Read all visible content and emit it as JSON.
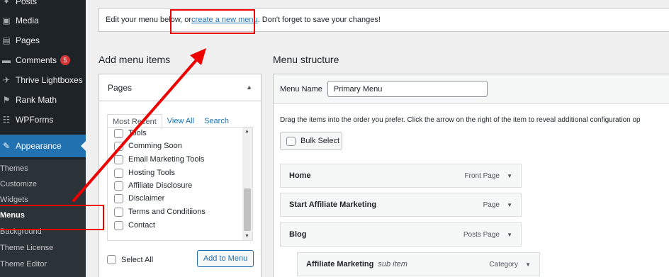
{
  "sidebar": {
    "items": [
      {
        "label": "Posts",
        "icon": "pin-icon"
      },
      {
        "label": "Media",
        "icon": "media-icon"
      },
      {
        "label": "Pages",
        "icon": "pages-icon"
      },
      {
        "label": "Comments",
        "icon": "comment-icon",
        "badge": "5"
      },
      {
        "label": "Thrive Lightboxes",
        "icon": "pin-icon"
      },
      {
        "label": "Rank Math",
        "icon": "chart-icon"
      },
      {
        "label": "WPForms",
        "icon": "forms-icon"
      }
    ],
    "appearance": "Appearance",
    "submenu": [
      "Themes",
      "Customize",
      "Widgets",
      "Menus",
      "Background",
      "Theme License",
      "Theme Editor"
    ]
  },
  "notice": {
    "before": "Edit your menu below, or ",
    "link": "create a new menu",
    "after": ". Don't forget to save your changes!"
  },
  "add_items": {
    "heading": "Add menu items",
    "panel_title": "Pages",
    "tabs": [
      "Most Recent",
      "View All",
      "Search"
    ],
    "pages": [
      "Tools",
      "Comming Soon",
      "Email Marketing Tools",
      "Hosting Tools",
      "Affiliate Disclosure",
      "Disclaimer",
      "Terms and Conditiions",
      "Contact"
    ],
    "select_all": "Select All",
    "add_button": "Add to Menu"
  },
  "structure": {
    "heading": "Menu structure",
    "menu_name_label": "Menu Name",
    "menu_name_value": "Primary Menu",
    "drag_help": "Drag the items into the order you prefer. Click the arrow on the right of the item to reveal additional configuration op",
    "bulk_select": "Bulk Select",
    "items": [
      {
        "title": "Home",
        "type": "Front Page"
      },
      {
        "title": "Start Affiliate Marketing",
        "type": "Page"
      },
      {
        "title": "Blog",
        "type": "Posts Page"
      },
      {
        "title": "Affiliate Marketing",
        "sub": "sub item",
        "type": "Category"
      }
    ]
  },
  "colors": {
    "accent": "#2271b1",
    "annotation": "#ee0000",
    "sidebar_bg": "#1d2327"
  }
}
